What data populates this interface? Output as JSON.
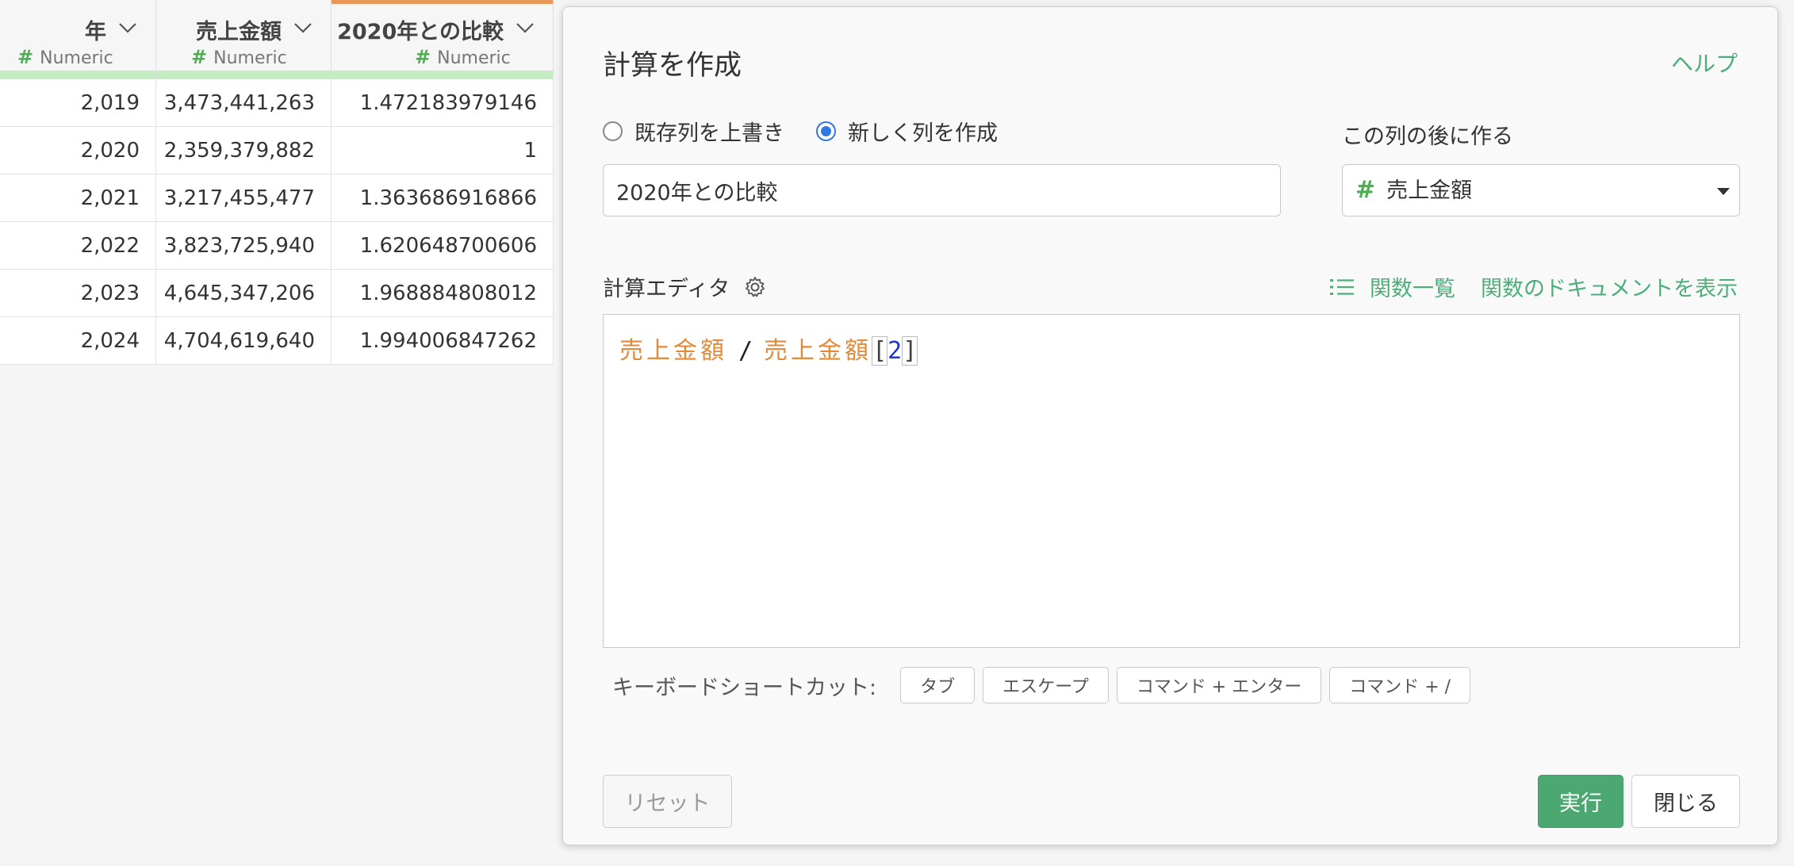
{
  "grid": {
    "columns": [
      {
        "name": "年",
        "type": "Numeric"
      },
      {
        "name": "売上金額",
        "type": "Numeric"
      },
      {
        "name": "2020年との比較",
        "type": "Numeric"
      }
    ],
    "rows": [
      [
        "2,019",
        "3,473,441,263",
        "1.472183979146"
      ],
      [
        "2,020",
        "2,359,379,882",
        "1"
      ],
      [
        "2,021",
        "3,217,455,477",
        "1.363686916866"
      ],
      [
        "2,022",
        "3,823,725,940",
        "1.620648700606"
      ],
      [
        "2,023",
        "4,645,347,206",
        "1.968884808012"
      ],
      [
        "2,024",
        "4,704,619,640",
        "1.994006847262"
      ]
    ],
    "hash_symbol": "#"
  },
  "dialog": {
    "title": "計算を作成",
    "help": "ヘルプ",
    "radio_overwrite": "既存列を上書き",
    "radio_new": "新しく列を作成",
    "selected_mode": "new",
    "after_label": "この列の後に作る",
    "column_name_value": "2020年との比較",
    "after_column": "売上金額",
    "editor_label": "計算エディタ",
    "function_list": "関数一覧",
    "function_docs": "関数のドキュメントを表示",
    "expression": {
      "col1": "売上金額",
      "op": "/",
      "col2": "売上金額",
      "bracket_open": "[",
      "index": "2",
      "bracket_close": "]"
    },
    "shortcut_label": "キーボードショートカット:",
    "shortcuts": [
      "タブ",
      "エスケープ",
      "コマンド + エンター",
      "コマンド + /"
    ],
    "reset": "リセット",
    "run": "実行",
    "close": "閉じる"
  },
  "colors": {
    "accent_green": "#4aa870",
    "link_green": "#4caf7a",
    "active_column": "#e8965a",
    "quality_bar": "#c5ecc0",
    "radio_blue": "#2f79e0",
    "column_token": "#e08a3a"
  },
  "icons": [
    "chevron-down-icon",
    "gear-icon",
    "list-icon",
    "dropdown-caret-icon"
  ]
}
